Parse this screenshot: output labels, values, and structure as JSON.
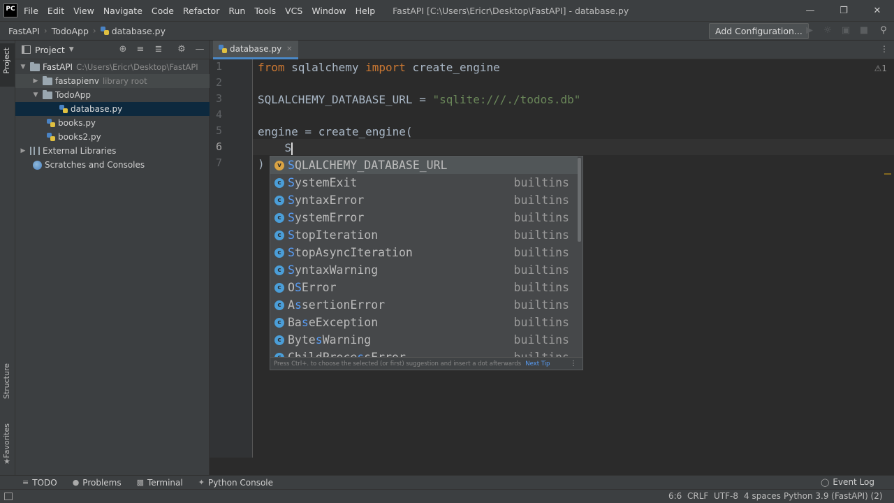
{
  "menu": {
    "app_logo": "PC",
    "items": [
      "File",
      "Edit",
      "View",
      "Navigate",
      "Code",
      "Refactor",
      "Run",
      "Tools",
      "VCS",
      "Window",
      "Help"
    ],
    "window_title": "FastAPI [C:\\Users\\Ericr\\Desktop\\FastAPI] - database.py"
  },
  "navbar": {
    "crumbs": [
      "FastAPI",
      "TodoApp",
      "database.py"
    ],
    "add_configuration": "Add Configuration..."
  },
  "left_strip": {
    "project": "Project",
    "structure": "Structure",
    "favorites": "Favorites"
  },
  "project_panel": {
    "title": "Project",
    "tree": [
      {
        "label": "FastAPI",
        "hint": "C:\\Users\\Ericr\\Desktop\\FastAPI",
        "arrow": "▼",
        "icon": "folder-icon"
      },
      {
        "label": "fastapienv",
        "hint": "library root",
        "arrow": "▶",
        "icon": "folder-icon"
      },
      {
        "label": "TodoApp",
        "hint": "",
        "arrow": "▼",
        "icon": "folder-icon"
      },
      {
        "label": "database.py",
        "hint": "",
        "arrow": "",
        "icon": "python-file-icon"
      },
      {
        "label": "books.py",
        "hint": "",
        "arrow": "",
        "icon": "python-file-icon"
      },
      {
        "label": "books2.py",
        "hint": "",
        "arrow": "",
        "icon": "python-file-icon"
      },
      {
        "label": "External Libraries",
        "hint": "",
        "arrow": "▶",
        "icon": "library-icon"
      },
      {
        "label": "Scratches and Consoles",
        "hint": "",
        "arrow": "",
        "icon": "scratch-icon"
      }
    ]
  },
  "editor": {
    "tab_label": "database.py",
    "warning_indicator": "⚠1",
    "line_numbers": [
      "1",
      "2",
      "3",
      "4",
      "5",
      "6",
      "7"
    ],
    "lines": {
      "l1_kw1": "from",
      "l1_mid": " sqlalchemy ",
      "l1_kw2": "import",
      "l1_end": " create_engine",
      "l3_var": "SQLALCHEMY_DATABASE_URL = ",
      "l3_str": "\"sqlite:///./todos.db\"",
      "l5": "engine = create_engine(",
      "l6": "    S",
      "l7": ")"
    }
  },
  "completion": {
    "items": [
      {
        "badge": "v",
        "match": "S",
        "rest": "QLALCHEMY_DATABASE_URL",
        "source": ""
      },
      {
        "badge": "c",
        "match": "S",
        "rest": "ystemExit",
        "source": "builtins"
      },
      {
        "badge": "c",
        "match": "S",
        "rest": "yntaxError",
        "source": "builtins"
      },
      {
        "badge": "c",
        "match": "S",
        "rest": "ystemError",
        "source": "builtins"
      },
      {
        "badge": "c",
        "match": "S",
        "rest": "topIteration",
        "source": "builtins"
      },
      {
        "badge": "c",
        "match": "S",
        "rest": "topAsyncIteration",
        "source": "builtins"
      },
      {
        "badge": "c",
        "match": "S",
        "rest": "yntaxWarning",
        "source": "builtins"
      },
      {
        "badge": "c",
        "pre": "O",
        "match": "S",
        "rest": "Error",
        "source": "builtins"
      },
      {
        "badge": "c",
        "pre": "A",
        "match": "s",
        "rest": "sertionError",
        "source": "builtins"
      },
      {
        "badge": "c",
        "pre": "Ba",
        "match": "s",
        "rest": "eException",
        "source": "builtins"
      },
      {
        "badge": "c",
        "pre": "Byte",
        "match": "s",
        "rest": "Warning",
        "source": "builtins"
      },
      {
        "badge": "c",
        "pre": "ChildProce",
        "match": "s",
        "rest": "sError",
        "source": "builtins"
      }
    ],
    "footer": "Press Ctrl+. to choose the selected (or first) suggestion and insert a dot afterwards",
    "next_tip": "Next Tip"
  },
  "bottom_tools": {
    "todo": "TODO",
    "problems": "Problems",
    "terminal": "Terminal",
    "python_console": "Python Console",
    "event_log": "Event Log"
  },
  "statusbar": {
    "position": "6:6",
    "line_sep": "CRLF",
    "encoding": "UTF-8",
    "indent": "4 spaces",
    "interpreter": "Python 3.9 (FastAPI) (2)"
  }
}
